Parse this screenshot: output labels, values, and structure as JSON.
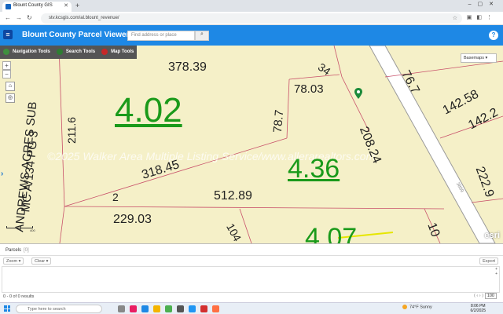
{
  "browser": {
    "tab_title": "Blount County GIS",
    "url": "stv.kcsgis.com/al.blount_revenue/"
  },
  "app": {
    "title": "Blount County Parcel Viewer",
    "search_placeholder": "Find address or place",
    "accent_color": "#1e88e5"
  },
  "toolbar": {
    "items": [
      {
        "label": "Navigation Tools",
        "icon": "navigation-icon",
        "color": "#3f8f3f"
      },
      {
        "label": "Search Tools",
        "icon": "search-tools-icon",
        "color": "#2e7d32"
      },
      {
        "label": "Map Tools",
        "icon": "map-tools-icon",
        "color": "#c62828"
      }
    ]
  },
  "map": {
    "basemaps_label": "Basemaps ▾",
    "parcel_labels": [
      "4.02",
      "4.36",
      "4.07"
    ],
    "dimension_labels": [
      "378.39",
      "34",
      "76.7",
      "78.03",
      "142.58",
      "142.2",
      "211.6",
      "78.7",
      "208.24",
      "318.45",
      "2",
      "512.89",
      "222.9",
      "229.03",
      "104",
      "10"
    ],
    "subdivision_label_1": "ANDREWS ACRES SUB",
    "subdivision_label_2": "MC A/134  PG 3",
    "road_label": "3899",
    "watermark": "©2025 Walker Area Multiple Listing Service/www.allerarealtors.com",
    "scale_label": "400",
    "attribution": "esri",
    "parcel_label_color": "#1a9a1a"
  },
  "panel": {
    "tab_label": "Parcels",
    "tab_count": "[0]",
    "zoom_label": "Zoom ▾",
    "clear_label": "Clear ▾",
    "export_label": "Export",
    "status": "0 - 0 of 0 results",
    "page_size": "100"
  },
  "taskbar": {
    "search_placeholder": "Type here to search",
    "weather": "74°F  Sunny",
    "time": "8:06 PM",
    "date": "6/2/2025"
  }
}
